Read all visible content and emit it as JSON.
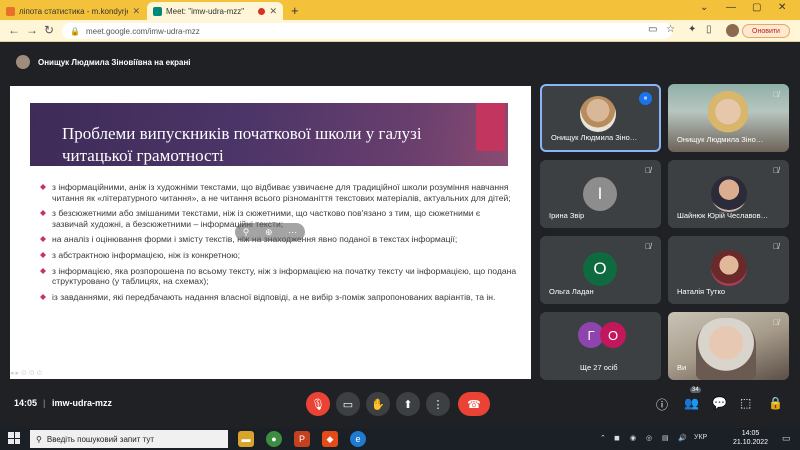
{
  "browser": {
    "tabs": [
      {
        "title": "ліпота статистика - m.kondyrjev…",
        "favicon_color": "#e8702a"
      },
      {
        "title": "Meet: \"imw-udra-mzz\"",
        "favicon_color": "#00897b"
      }
    ],
    "new_tab": "+",
    "url": "meet.google.com/imw-udra-mzz",
    "update_button": "Оновити"
  },
  "presenting": {
    "banner": "Онищук Людмила Зіновіївна на екрані"
  },
  "slide": {
    "title": "Проблеми випускників початкової школи у галузі читацької грамотності",
    "bullets": [
      "з інформаційними, аніж із художніми текстами, що відбиває узвичаєне для традиційної школи розуміння навчання читання як «літературного читання», а не читання всього різноманіття текстових матеріалів, актуальних для дітей;",
      "з безсюжетними або змішаними текстами, ніж із сюжетними, що частково пов'язано з тим, що сюжетними є зазвичай художні, а безсюжетними – інформаційні тексти;",
      "на аналіз і оцінювання форми і змісту текстів, ніж на знаходження явно поданої в текстах інформації;",
      "з абстрактною інформацією, ніж із конкретною;",
      "з інформацією, яка розпорошена по всьому тексту, ніж з інформацією на початку тексту чи інформацією, що подана структуровано (у таблицях, на схемах);",
      "із завданнями, які передбачають надання власної відповіді, а не вибір з-поміж запропонованих варіантів, та ін."
    ]
  },
  "participants": [
    {
      "name": "Онищук Людмила Зіно…",
      "kind": "photo",
      "active": true,
      "speaking": true
    },
    {
      "name": "Онищук Людмила Зіно…",
      "kind": "video",
      "active": false,
      "speaking": false
    },
    {
      "name": "Ірина Звір",
      "kind": "letter",
      "letter": "І",
      "color": "#8d8d8d"
    },
    {
      "name": "Шайнюк Юрій Чеславов…",
      "kind": "photo"
    },
    {
      "name": "Ольга Ладан",
      "kind": "letter",
      "letter": "О",
      "color": "#0f6a3f"
    },
    {
      "name": "Наталія Тутко",
      "kind": "photo"
    },
    {
      "name": "Ще 27 осіб",
      "kind": "group",
      "letters": [
        "Г",
        "О"
      ],
      "colors": [
        "#8e44ad",
        "#c2185b"
      ]
    },
    {
      "name": "Ви",
      "kind": "video"
    }
  ],
  "meeting": {
    "time": "14:05",
    "separator": "|",
    "code": "imw-udra-mzz",
    "participant_count": "34"
  },
  "taskbar": {
    "search_placeholder": "Введіть пошуковий запит тут",
    "language": "УКР",
    "time": "14:05",
    "date": "21.10.2022"
  }
}
